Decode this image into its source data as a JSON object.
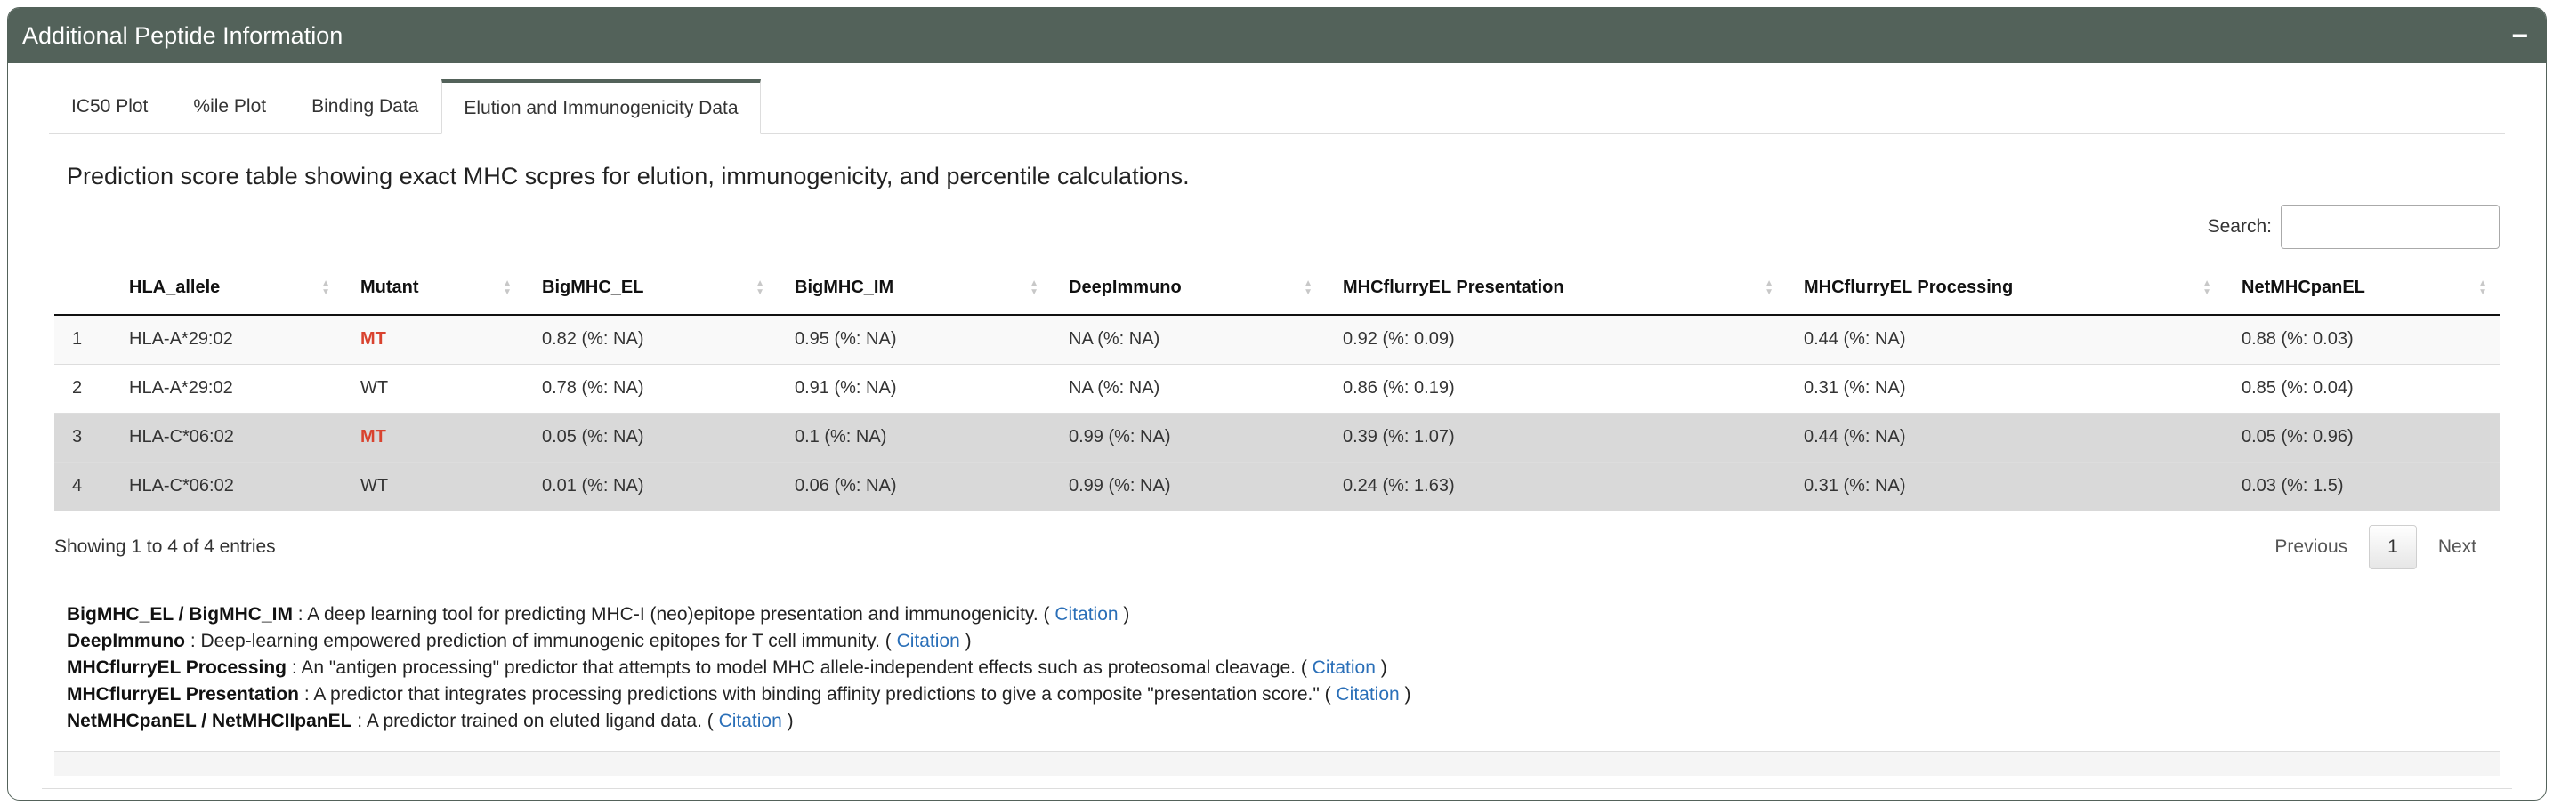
{
  "panel": {
    "title": "Additional Peptide Information",
    "collapse_symbol": "−"
  },
  "tabs": [
    {
      "label": "IC50 Plot"
    },
    {
      "label": "%ile Plot"
    },
    {
      "label": "Binding Data"
    },
    {
      "label": "Elution and Immunogenicity Data",
      "active": true
    }
  ],
  "description": "Prediction score table showing exact MHC scpres for elution, immunogenicity, and percentile calculations.",
  "search": {
    "label": "Search:",
    "value": ""
  },
  "table": {
    "columns": [
      "",
      "HLA_allele",
      "Mutant",
      "BigMHC_EL",
      "BigMHC_IM",
      "DeepImmuno",
      "MHCflurryEL Presentation",
      "MHCflurryEL Processing",
      "NetMHCpanEL"
    ],
    "rows": [
      [
        "1",
        "HLA-A*29:02",
        "MT",
        "0.82 (%: NA)",
        "0.95 (%: NA)",
        "NA (%: NA)",
        "0.92 (%: 0.09)",
        "0.44 (%: NA)",
        "0.88 (%: 0.03)"
      ],
      [
        "2",
        "HLA-A*29:02",
        "WT",
        "0.78 (%: NA)",
        "0.91 (%: NA)",
        "NA (%: NA)",
        "0.86 (%: 0.19)",
        "0.31 (%: NA)",
        "0.85 (%: 0.04)"
      ],
      [
        "3",
        "HLA-C*06:02",
        "MT",
        "0.05 (%: NA)",
        "0.1 (%: NA)",
        "0.99 (%: NA)",
        "0.39 (%: 1.07)",
        "0.44 (%: NA)",
        "0.05 (%: 0.96)"
      ],
      [
        "4",
        "HLA-C*06:02",
        "WT",
        "0.01 (%: NA)",
        "0.06 (%: NA)",
        "0.99 (%: NA)",
        "0.24 (%: 1.63)",
        "0.31 (%: NA)",
        "0.03 (%: 1.5)"
      ]
    ],
    "mutant_color": "#d9432f"
  },
  "info": "Showing 1 to 4 of 4 entries",
  "pagination": {
    "previous": "Previous",
    "current": "1",
    "next": "Next"
  },
  "references": [
    {
      "name": "BigMHC_EL / BigMHC_IM",
      "text": " : A deep learning tool for predicting MHC-I (neo)epitope presentation and immunogenicity. ( ",
      "link": "Citation",
      "close": " )"
    },
    {
      "name": "DeepImmuno",
      "text": " : Deep-learning empowered prediction of immunogenic epitopes for T cell immunity. ( ",
      "link": "Citation",
      "close": " )"
    },
    {
      "name": "MHCflurryEL Processing",
      "text": " : An \"antigen processing\" predictor that attempts to model MHC allele-independent effects such as proteosomal cleavage. ( ",
      "link": "Citation",
      "close": " )"
    },
    {
      "name": "MHCflurryEL Presentation",
      "text": " : A predictor that integrates processing predictions with binding affinity predictions to give a composite \"presentation score.\" ( ",
      "link": "Citation",
      "close": " )"
    },
    {
      "name": "NetMHCpanEL / NetMHCIIpanEL",
      "text": " : A predictor trained on eluted ligand data. ( ",
      "link": "Citation",
      "close": " )"
    }
  ],
  "colors": {
    "header_bg": "#53625a",
    "link": "#2a6fb8",
    "highlight_row": "#d9d9d9"
  }
}
